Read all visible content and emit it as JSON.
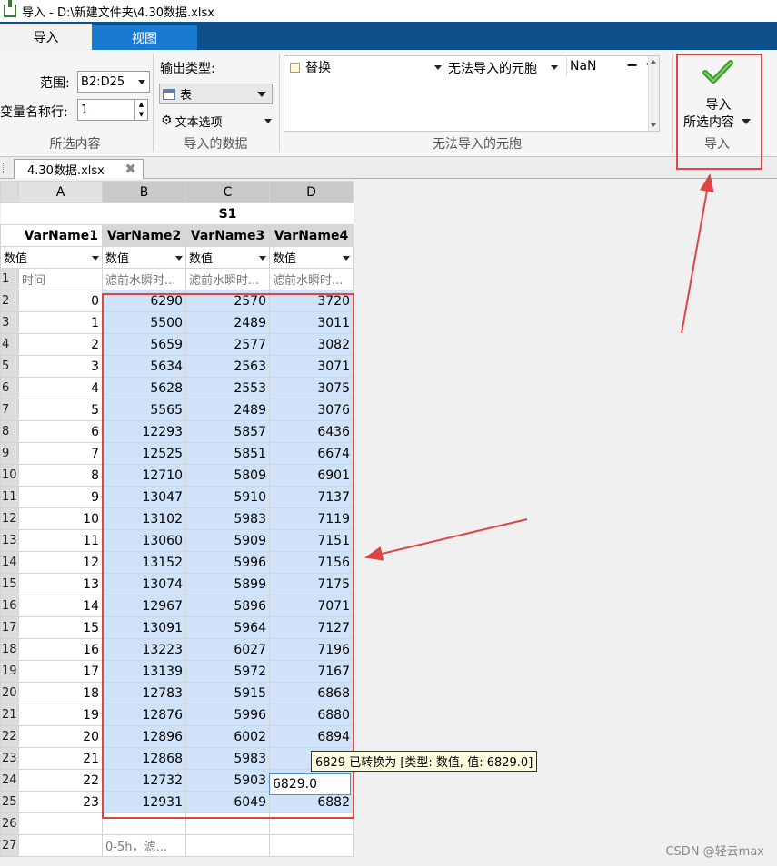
{
  "window": {
    "title": "导入 - D:\\新建文件夹\\4.30数据.xlsx"
  },
  "tabs": [
    "导入",
    "视图"
  ],
  "ribbon": {
    "selection": {
      "range_label": "范围:",
      "range_value": "B2:D25",
      "varname_row_label": "变量名称行:",
      "varname_row_value": "1",
      "group_label": "所选内容"
    },
    "imported_data": {
      "output_type_label": "输出类型:",
      "output_type_value": "表",
      "text_options_label": "文本选项",
      "group_label": "导入的数据"
    },
    "unimportable": {
      "rule_action": "替换",
      "rule_target": "无法导入的元胞",
      "rule_value": "NaN",
      "minus": "−",
      "plus": "+",
      "group_label": "无法导入的元胞"
    },
    "import": {
      "button_line1": "导入",
      "button_line2": "所选内容",
      "group_label": "导入"
    }
  },
  "file_tab": {
    "label": "4.30数据.xlsx",
    "close": "✖"
  },
  "sheet": {
    "columns": [
      "A",
      "B",
      "C",
      "D"
    ],
    "sheet_name": "S1",
    "var_names": [
      "VarName1",
      "VarName2",
      "VarName3",
      "VarName4"
    ],
    "types": [
      "数值",
      "数值",
      "数值",
      "数值"
    ],
    "row1_desc": [
      "时间",
      "滤前水瞬时...",
      "滤前水瞬时...",
      "滤前水瞬时..."
    ],
    "rows": [
      {
        "n": "2",
        "a": "0",
        "b": "6290",
        "c": "2570",
        "d": "3720"
      },
      {
        "n": "3",
        "a": "1",
        "b": "5500",
        "c": "2489",
        "d": "3011"
      },
      {
        "n": "4",
        "a": "2",
        "b": "5659",
        "c": "2577",
        "d": "3082"
      },
      {
        "n": "5",
        "a": "3",
        "b": "5634",
        "c": "2563",
        "d": "3071"
      },
      {
        "n": "6",
        "a": "4",
        "b": "5628",
        "c": "2553",
        "d": "3075"
      },
      {
        "n": "7",
        "a": "5",
        "b": "5565",
        "c": "2489",
        "d": "3076"
      },
      {
        "n": "8",
        "a": "6",
        "b": "12293",
        "c": "5857",
        "d": "6436"
      },
      {
        "n": "9",
        "a": "7",
        "b": "12525",
        "c": "5851",
        "d": "6674"
      },
      {
        "n": "10",
        "a": "8",
        "b": "12710",
        "c": "5809",
        "d": "6901"
      },
      {
        "n": "11",
        "a": "9",
        "b": "13047",
        "c": "5910",
        "d": "7137"
      },
      {
        "n": "12",
        "a": "10",
        "b": "13102",
        "c": "5983",
        "d": "7119"
      },
      {
        "n": "13",
        "a": "11",
        "b": "13060",
        "c": "5909",
        "d": "7151"
      },
      {
        "n": "14",
        "a": "12",
        "b": "13152",
        "c": "5996",
        "d": "7156"
      },
      {
        "n": "15",
        "a": "13",
        "b": "13074",
        "c": "5899",
        "d": "7175"
      },
      {
        "n": "16",
        "a": "14",
        "b": "12967",
        "c": "5896",
        "d": "7071"
      },
      {
        "n": "17",
        "a": "15",
        "b": "13091",
        "c": "5964",
        "d": "7127"
      },
      {
        "n": "18",
        "a": "16",
        "b": "13223",
        "c": "6027",
        "d": "7196"
      },
      {
        "n": "19",
        "a": "17",
        "b": "13139",
        "c": "5972",
        "d": "7167"
      },
      {
        "n": "20",
        "a": "18",
        "b": "12783",
        "c": "5915",
        "d": "6868"
      },
      {
        "n": "21",
        "a": "19",
        "b": "12876",
        "c": "5996",
        "d": "6880"
      },
      {
        "n": "22",
        "a": "20",
        "b": "12896",
        "c": "6002",
        "d": "6894"
      },
      {
        "n": "23",
        "a": "21",
        "b": "12868",
        "c": "5983",
        "d": ""
      },
      {
        "n": "24",
        "a": "22",
        "b": "12732",
        "c": "5903",
        "d": ""
      },
      {
        "n": "25",
        "a": "23",
        "b": "12931",
        "c": "6049",
        "d": "6882"
      },
      {
        "n": "26",
        "a": "",
        "b": "",
        "c": "",
        "d": ""
      },
      {
        "n": "27",
        "a": "",
        "b": "0-5h，滤...",
        "c": "",
        "d": ""
      }
    ],
    "row1_number": "1"
  },
  "tooltip": "6829 已转换为 [类型: 数值, 值: 6829.0]",
  "edit_cell_value": "6829.0",
  "watermark": "CSDN @轻云max",
  "colors": {
    "accent_blue": "#0d4f8b",
    "tab_view": "#1a7ad0",
    "selection": "#cfe2f7",
    "annotation_red": "#e04545",
    "check_green": "#3a9d2c"
  }
}
